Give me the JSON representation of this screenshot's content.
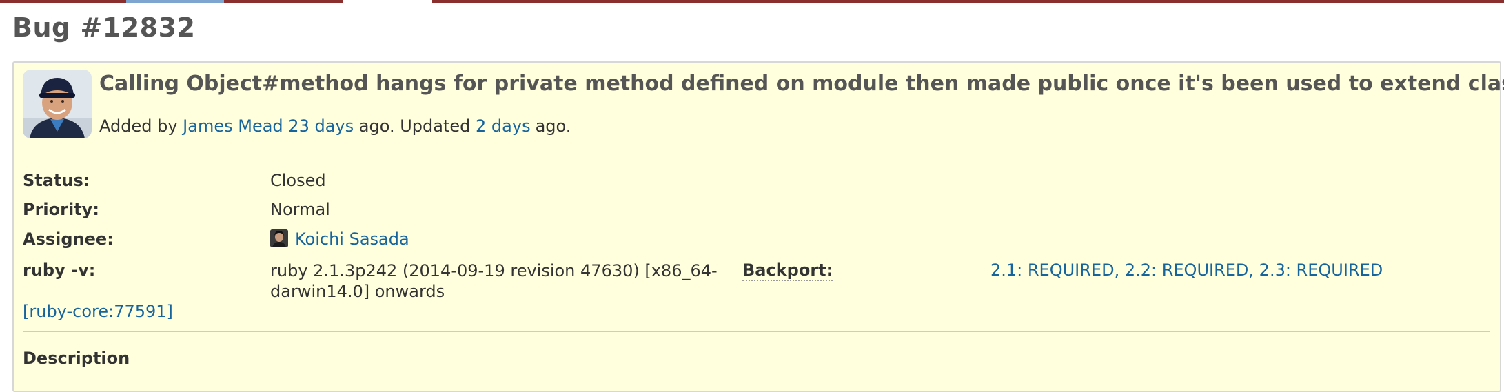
{
  "colors": {
    "tab_active": "#7ea5cf",
    "tab_bar": "#8b2e2e",
    "issue_background": "#ffffdd",
    "link": "#16649e"
  },
  "page": {
    "title": "Bug #12832"
  },
  "issue": {
    "subject": "Calling Object#method hangs for private method defined on module then made public once it's been used to extend class",
    "author": {
      "prefix": "Added by",
      "name": "James Mead",
      "created_ago": "23 days",
      "created_suffix": "ago. Updated",
      "updated_ago": "2 days",
      "updated_suffix": "ago."
    },
    "attributes": {
      "status": {
        "label": "Status:",
        "value": "Closed"
      },
      "priority": {
        "label": "Priority:",
        "value": "Normal"
      },
      "assignee": {
        "label": "Assignee:",
        "value": "Koichi Sasada"
      },
      "ruby_v": {
        "label": "ruby -v:",
        "value": "ruby 2.1.3p242 (2014-09-19 revision 47630) [x86_64-darwin14.0] onwards"
      },
      "backport": {
        "label": "Backport:",
        "value": "2.1: REQUIRED, 2.2: REQUIRED, 2.3: REQUIRED"
      }
    },
    "reference": "[ruby-core:77591]",
    "description_heading": "Description"
  }
}
